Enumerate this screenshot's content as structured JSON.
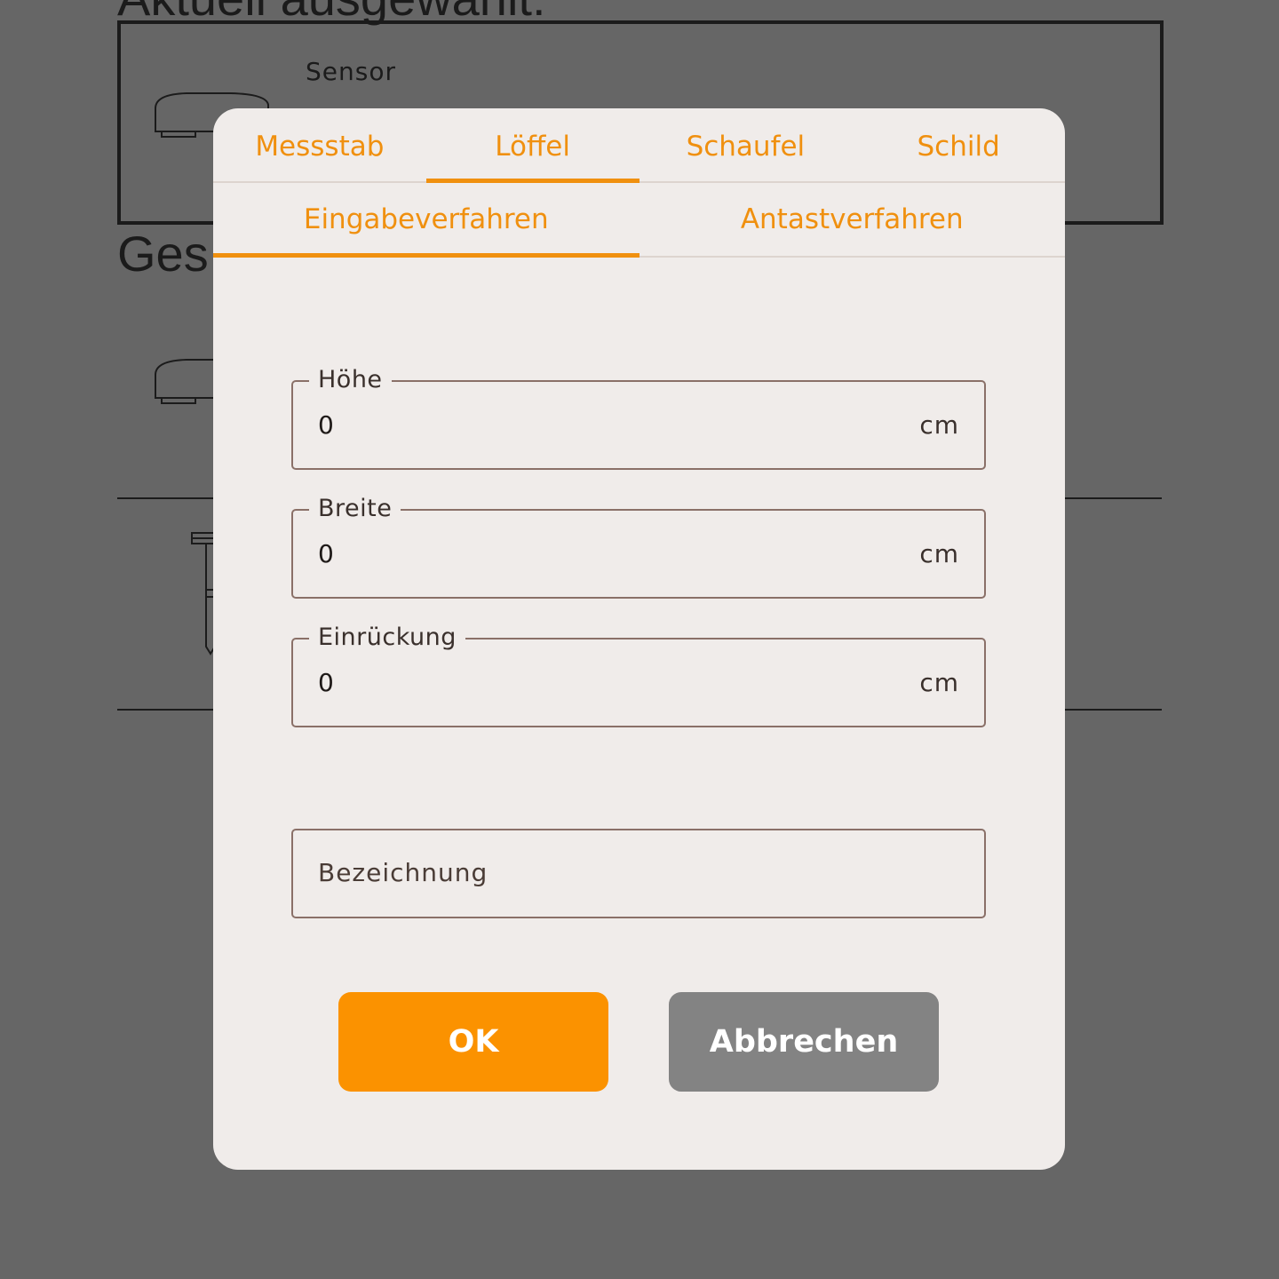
{
  "background": {
    "heading_top": "Aktuell ausgewählt:",
    "selected_item_label": "Sensor",
    "heading_second": "Ges"
  },
  "dialog": {
    "tabs": [
      {
        "label": "Messstab",
        "active": false
      },
      {
        "label": "Löffel",
        "active": true
      },
      {
        "label": "Schaufel",
        "active": false
      },
      {
        "label": "Schild",
        "active": false
      }
    ],
    "subtabs": [
      {
        "label": "Eingabeverfahren",
        "active": true
      },
      {
        "label": "Antastverfahren",
        "active": false
      }
    ],
    "fields": {
      "height": {
        "label": "Höhe",
        "value": "0",
        "unit": "cm"
      },
      "width": {
        "label": "Breite",
        "value": "0",
        "unit": "cm"
      },
      "indent": {
        "label": "Einrückung",
        "value": "0",
        "unit": "cm"
      }
    },
    "name_field": {
      "placeholder": "Bezeichnung"
    },
    "buttons": {
      "ok": "OK",
      "cancel": "Abbrechen"
    }
  },
  "colors": {
    "accent": "#f0900f",
    "ok_button": "#fb9200",
    "cancel_button": "#838383",
    "dialog_background": "#f0ecea",
    "overlay": "#666666"
  }
}
